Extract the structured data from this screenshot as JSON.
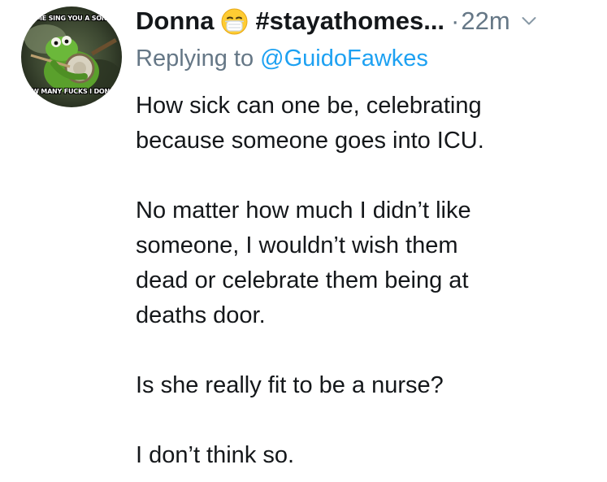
{
  "avatar": {
    "top_text": "LET ME SING YOU A SONG OF",
    "bottom_text": "HOW MANY FUCKS I DON'T GIVE"
  },
  "header": {
    "display_name": "Donna",
    "emoji_icon": "face-with-medical-mask-icon",
    "handle_truncated": "#stayathomes...",
    "separator": "·",
    "timestamp": "22m",
    "menu_icon": "chevron-down-icon"
  },
  "reply": {
    "prefix": "Replying to",
    "mention": "@GuidoFawkes"
  },
  "tweet": {
    "paragraphs": [
      "How sick can one be, celebrating\nbecause someone goes into ICU.",
      "No matter how much I didn’t like\nsomeone, I wouldn’t wish them\ndead or celebrate them being at\ndeaths door.",
      "Is she really fit to be a nurse?",
      "I don’t think so."
    ]
  },
  "colors": {
    "primary_text": "#14171a",
    "secondary_text": "#657786",
    "link": "#1da1f2",
    "background": "#ffffff"
  }
}
